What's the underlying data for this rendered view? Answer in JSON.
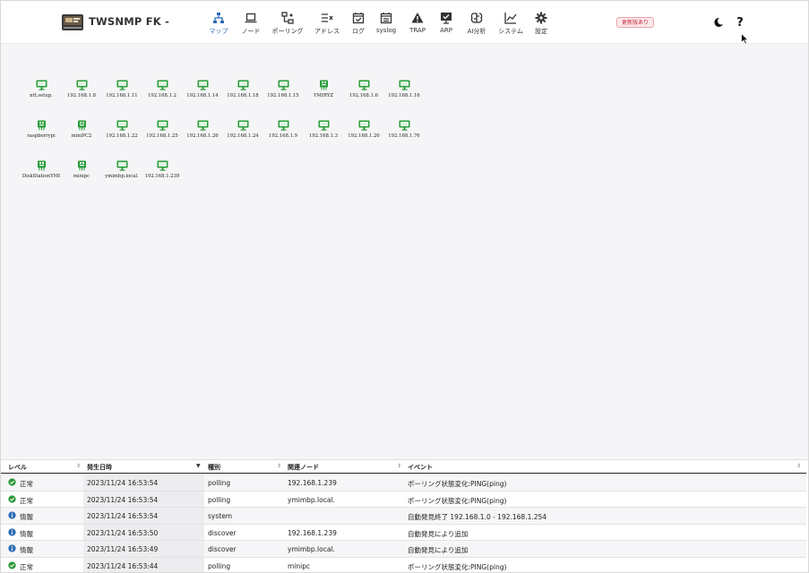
{
  "app": {
    "title": "TWSNMP FK -"
  },
  "nav": [
    {
      "id": "map",
      "label": "マップ",
      "icon": "network-map-icon",
      "active": true
    },
    {
      "id": "node",
      "label": "ノード",
      "icon": "laptop-icon"
    },
    {
      "id": "polling",
      "label": "ポーリング",
      "icon": "polling-icon"
    },
    {
      "id": "address",
      "label": "アドレス",
      "icon": "address-list-icon"
    },
    {
      "id": "log",
      "label": "ログ",
      "icon": "calendar-check-icon"
    },
    {
      "id": "syslog",
      "label": "syslog",
      "icon": "calendar-list-icon"
    },
    {
      "id": "trap",
      "label": "TRAP",
      "icon": "warning-triangle-icon"
    },
    {
      "id": "arp",
      "label": "ARP",
      "icon": "monitor-check-icon"
    },
    {
      "id": "ai",
      "label": "AI分析",
      "icon": "brain-icon"
    },
    {
      "id": "system",
      "label": "システム",
      "icon": "line-chart-icon"
    },
    {
      "id": "settings",
      "label": "設定",
      "icon": "gear-icon"
    }
  ],
  "header": {
    "update_badge": "更新版あり",
    "help_label": "?",
    "theme_label": "☽"
  },
  "map": {
    "nodes": [
      {
        "label": "ntt.setup.",
        "icon": "desktop-icon"
      },
      {
        "label": "192.168.1.8",
        "icon": "desktop-icon"
      },
      {
        "label": "192.168.1.11",
        "icon": "desktop-icon"
      },
      {
        "label": "192.168.1.2",
        "icon": "desktop-icon"
      },
      {
        "label": "192.168.1.14",
        "icon": "desktop-icon"
      },
      {
        "label": "192.168.1.18",
        "icon": "desktop-icon"
      },
      {
        "label": "192.168.1.15",
        "icon": "desktop-icon"
      },
      {
        "label": "YMIRYZ",
        "icon": "raspberry-pi-icon"
      },
      {
        "label": "192.168.1.6",
        "icon": "desktop-icon"
      },
      {
        "label": "192.168.1.16",
        "icon": "desktop-icon"
      },
      {
        "label": "raspberrypi",
        "icon": "raspberry-pi-icon"
      },
      {
        "label": "miniPC2",
        "icon": "raspberry-pi-icon"
      },
      {
        "label": "192.168.1.22",
        "icon": "desktop-icon"
      },
      {
        "label": "192.168.1.25",
        "icon": "desktop-icon"
      },
      {
        "label": "192.168.1.26",
        "icon": "desktop-icon"
      },
      {
        "label": "192.168.1.24",
        "icon": "desktop-icon"
      },
      {
        "label": "192.168.1.9",
        "icon": "desktop-icon"
      },
      {
        "label": "192.168.1.3",
        "icon": "desktop-icon"
      },
      {
        "label": "192.168.1.20",
        "icon": "desktop-icon"
      },
      {
        "label": "192.168.1.76",
        "icon": "desktop-icon"
      },
      {
        "label": "DiskStationYMI",
        "icon": "raspberry-pi-icon"
      },
      {
        "label": "minipc",
        "icon": "raspberry-pi-icon"
      },
      {
        "label": "ymimbp.local.",
        "icon": "desktop-icon"
      },
      {
        "label": "192.168.1.239",
        "icon": "desktop-icon"
      }
    ],
    "node_color": "#2a9d3a"
  },
  "events": {
    "columns": [
      "レベル",
      "発生日時",
      "種別",
      "関連ノード",
      "イベント"
    ],
    "rows": [
      {
        "level": "正常",
        "level_kind": "normal",
        "time": "2023/11/24 16:53:54",
        "type": "polling",
        "node": "192.168.1.239",
        "event": "ポーリング状態変化:PING(ping)"
      },
      {
        "level": "正常",
        "level_kind": "normal",
        "time": "2023/11/24 16:53:54",
        "type": "polling",
        "node": "ymimbp.local.",
        "event": "ポーリング状態変化:PING(ping)"
      },
      {
        "level": "情報",
        "level_kind": "info",
        "time": "2023/11/24 16:53:54",
        "type": "system",
        "node": "",
        "event": "自動発見終了 192.168.1.0 - 192.168.1.254"
      },
      {
        "level": "情報",
        "level_kind": "info",
        "time": "2023/11/24 16:53:50",
        "type": "discover",
        "node": "192.168.1.239",
        "event": "自動発見により追加"
      },
      {
        "level": "情報",
        "level_kind": "info",
        "time": "2023/11/24 16:53:49",
        "type": "discover",
        "node": "ymimbp.local.",
        "event": "自動発見により追加"
      },
      {
        "level": "正常",
        "level_kind": "normal",
        "time": "2023/11/24 16:53:44",
        "type": "polling",
        "node": "minipc",
        "event": "ポーリング状態変化:PING(ping)"
      }
    ],
    "colors": {
      "normal": "#2e9a3c",
      "info": "#2d6db5"
    }
  }
}
